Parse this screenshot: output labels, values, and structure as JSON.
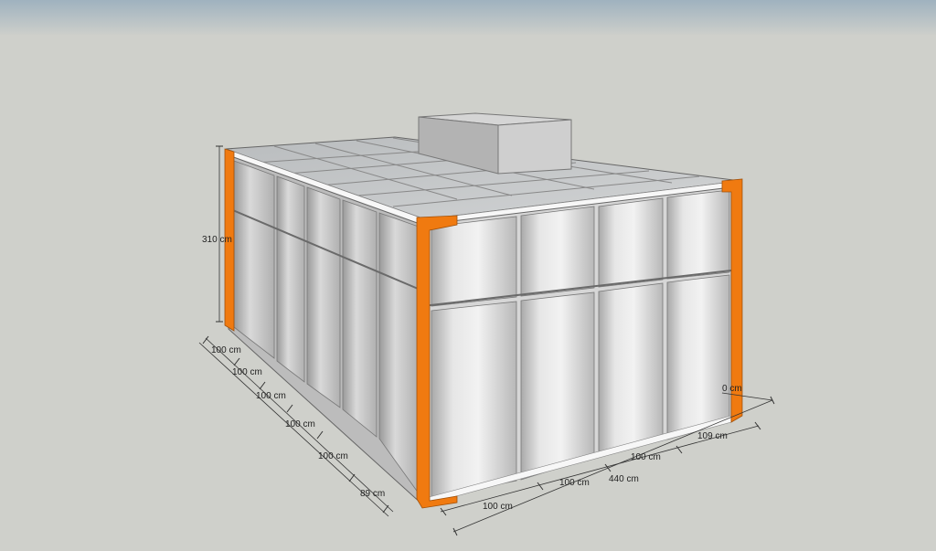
{
  "scene": {
    "colors": {
      "sky": "#a9b9c4",
      "ground": "#cfd0cb",
      "panel": "#d8d8d8",
      "panel_dark": "#bdbdbd",
      "frame_orange": "#f07a10",
      "edge_white": "#f7f7f7",
      "roof_panel": "#c9cbcc",
      "rooftop_unit": "#c7c7c7"
    }
  },
  "dimensions": {
    "height": "310 cm",
    "side_1": "100 cm",
    "side_2": "100 cm",
    "side_3": "100 cm",
    "side_4": "100 cm",
    "side_5": "100 cm",
    "side_6": "89 cm",
    "front_1": "100 cm",
    "front_2": "100 cm",
    "front_3": "100 cm",
    "front_4": "109 cm",
    "front_total": "440 cm",
    "partial_label": "0 cm"
  }
}
